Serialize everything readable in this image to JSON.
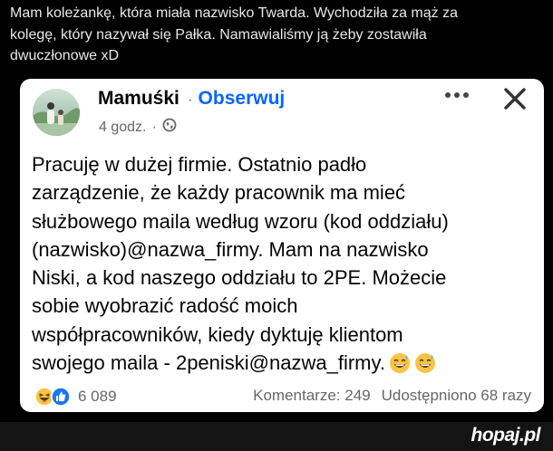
{
  "caption": {
    "lines": [
      "Mam koleżankę, która miała nazwisko Twarda. Wychodziła za mąż za",
      "kolegę, który nazywał się Pałka. Namawialiśmy ją żeby zostawiła",
      "dwuczłonowe xD"
    ]
  },
  "post": {
    "author": "Mamuśki",
    "separator": "·",
    "follow_label": "Obserwuj",
    "time": "4 godz.",
    "time_separator": "·",
    "privacy_icon": "globe-icon",
    "more_icon": "more-options-icon",
    "close_icon": "close-icon",
    "text_lines": [
      "Pracuję w dużej  firmie. Ostatnio padło",
      "zarządzenie, że każdy pracownik ma mieć",
      "służbowego maila według wzoru (kod oddziału)",
      "(nazwisko)@nazwa_firmy. Mam  na nazwisko",
      "Niski, a kod naszego oddziału to 2PE. Możecie",
      "sobie  wyobrazić radość moich",
      "współpracowników, kiedy dyktuję klientom",
      "swojego  maila - 2peniski@nazwa_firmy."
    ],
    "trailing_emojis": [
      "grinning-sweat-emoji",
      "grinning-sweat-emoji"
    ],
    "reactions": {
      "icons": [
        "haha-reaction-icon",
        "like-reaction-icon"
      ],
      "count": "6 089"
    },
    "comments_label": "Komentarze: 249",
    "shares_label": "Udostępniono 68 razy"
  },
  "watermark": "hopaj.pl",
  "colors": {
    "background": "#000000",
    "caption_text": "#e7e9ea",
    "card": "#ffffff",
    "follow": "#0866ff",
    "muted": "#65676b",
    "like_blue": "#1877f2",
    "haha_yellow": "#f7c544"
  }
}
